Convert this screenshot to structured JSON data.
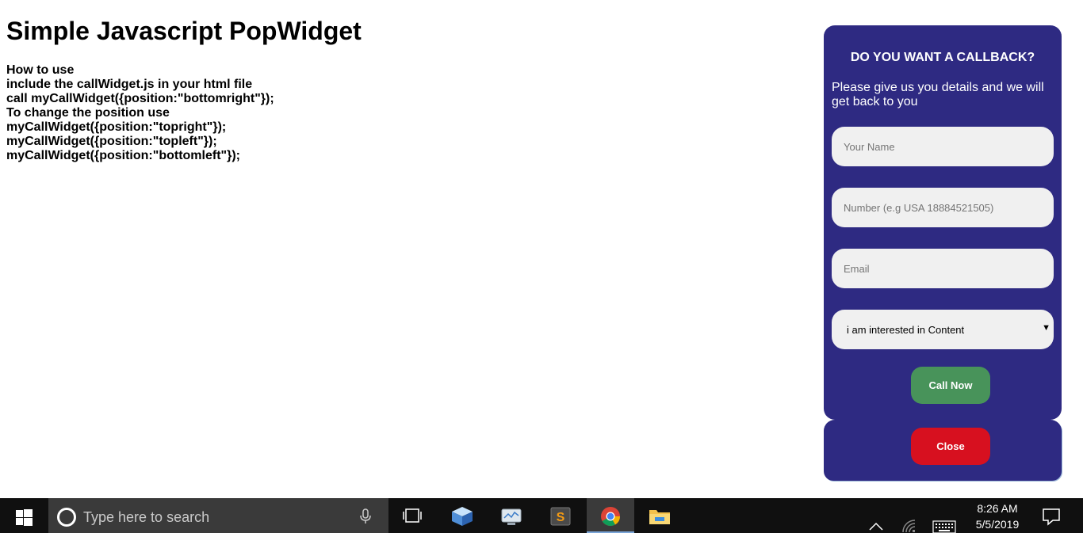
{
  "page": {
    "title": "Simple Javascript PopWidget",
    "instructions": [
      "How to use",
      "include the callWidget.js in your html file",
      "call myCallWidget({position:\"bottomright\"});",
      "To change the position use",
      "myCallWidget({position:\"topright\"});",
      "myCallWidget({position:\"topleft\"});",
      "myCallWidget({position:\"bottomleft\"});"
    ]
  },
  "widget": {
    "heading": "DO YOU WANT A CALLBACK?",
    "description": "Please give us you details and we will get back to you",
    "name_placeholder": "Your Name",
    "number_placeholder": "Number (e.g USA 18884521505)",
    "email_placeholder": "Email",
    "interest_value": "i am interested in Content",
    "call_button": "Call Now",
    "close_button": "Close",
    "colors": {
      "panel": "#2e2a82",
      "call_button": "#48935a",
      "close_button": "#d7101f",
      "field": "#f0f0f0"
    }
  },
  "taskbar": {
    "search_placeholder": "Type here to search",
    "icons": [
      "windows-start-icon",
      "cortana-icon",
      "microphone-icon",
      "task-view-icon",
      "virtualbox-icon",
      "network-drive-icon",
      "sublime-text-icon",
      "chrome-icon",
      "file-explorer-icon"
    ],
    "tray_icons": [
      "chevron-up-icon",
      "wifi-icon",
      "keyboard-icon",
      "notification-icon"
    ],
    "time": "8:26 AM",
    "date": "5/5/2019"
  }
}
